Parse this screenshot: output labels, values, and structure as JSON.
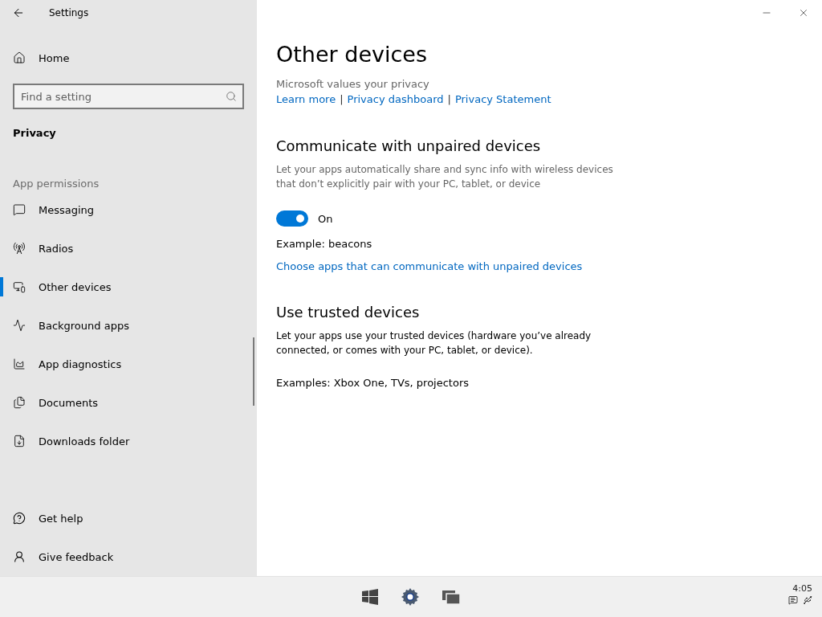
{
  "window": {
    "title": "Settings"
  },
  "sidebar": {
    "home": "Home",
    "search": {
      "placeholder": "Find a setting"
    },
    "section": "Privacy",
    "group_label": "App permissions",
    "items": [
      {
        "label": "Messaging",
        "selected": false
      },
      {
        "label": "Radios",
        "selected": false
      },
      {
        "label": "Other devices",
        "selected": true
      },
      {
        "label": "Background apps",
        "selected": false
      },
      {
        "label": "App diagnostics",
        "selected": false
      },
      {
        "label": "Documents",
        "selected": false
      },
      {
        "label": "Downloads folder",
        "selected": false
      }
    ],
    "footer": [
      {
        "label": "Get help"
      },
      {
        "label": "Give feedback"
      }
    ]
  },
  "page": {
    "title": "Other devices",
    "privacy_note": "Microsoft values your privacy",
    "link_separator": "|",
    "privacy_links": [
      {
        "label": "Learn more"
      },
      {
        "label": "Privacy dashboard"
      },
      {
        "label": "Privacy Statement"
      }
    ],
    "sections": [
      {
        "heading": "Communicate with unpaired devices",
        "description": "Let your apps automatically share and sync info with wireless devices that don’t explicitly pair with your PC, tablet, or device",
        "toggle": {
          "on": true,
          "label": "On"
        },
        "example": "Example: beacons",
        "link": "Choose apps that can communicate with unpaired devices"
      },
      {
        "heading": "Use trusted devices",
        "description": "Let your apps use your trusted devices (hardware you’ve already connected, or comes with your PC, tablet, or device).",
        "example": "Examples: Xbox One, TVs, projectors"
      }
    ]
  },
  "taskbar": {
    "clock": "4:05"
  }
}
